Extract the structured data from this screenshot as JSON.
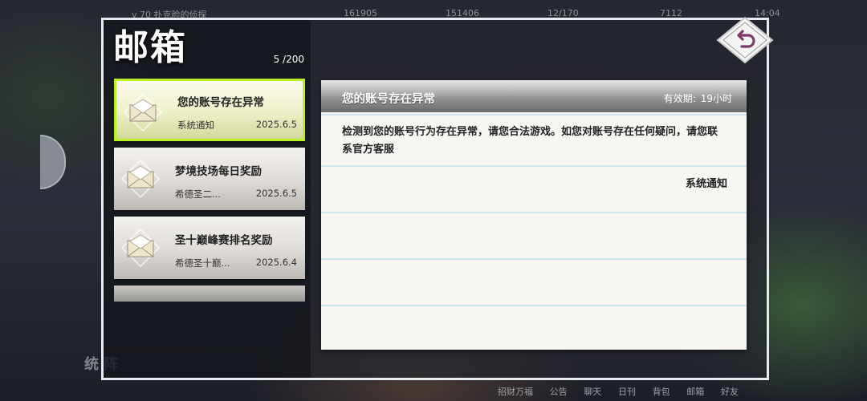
{
  "topbar": {
    "player": "v 70 扑克脸的侦探",
    "gold": "161905",
    "diamond": "151406",
    "stamina": "12/170",
    "crystal": "7112",
    "time": "14:04"
  },
  "bottom_nav": [
    "招财万福",
    "公告",
    "聊天",
    "日刊",
    "背包",
    "邮箱",
    "好友"
  ],
  "bg_left_text": "统 阵",
  "mailbox": {
    "title": "邮箱",
    "count": "5 /200",
    "mails": [
      {
        "title": "您的账号存在异常",
        "from": "系统通知",
        "date": "2025.6.5"
      },
      {
        "title": "梦境技场每日奖励",
        "from": "希德圣二...",
        "date": "2025.6.5"
      },
      {
        "title": "圣十巅峰赛排名奖励",
        "from": "希德圣十巅...",
        "date": "2025.6.4"
      }
    ]
  },
  "detail": {
    "title": "您的账号存在异常",
    "expire_label": "有效期:",
    "expire_value": "19小时",
    "body": "检测到您的账号行为存在异常，请您合法游戏。如您对账号存在任何疑问，请您联系官方客服",
    "sender": "系统通知"
  },
  "icons": {
    "back": "back-arrow-icon",
    "mail": "envelope-icon"
  },
  "colors": {
    "active_border": "#b8f028",
    "back_arrow": "#7a3b6a"
  }
}
